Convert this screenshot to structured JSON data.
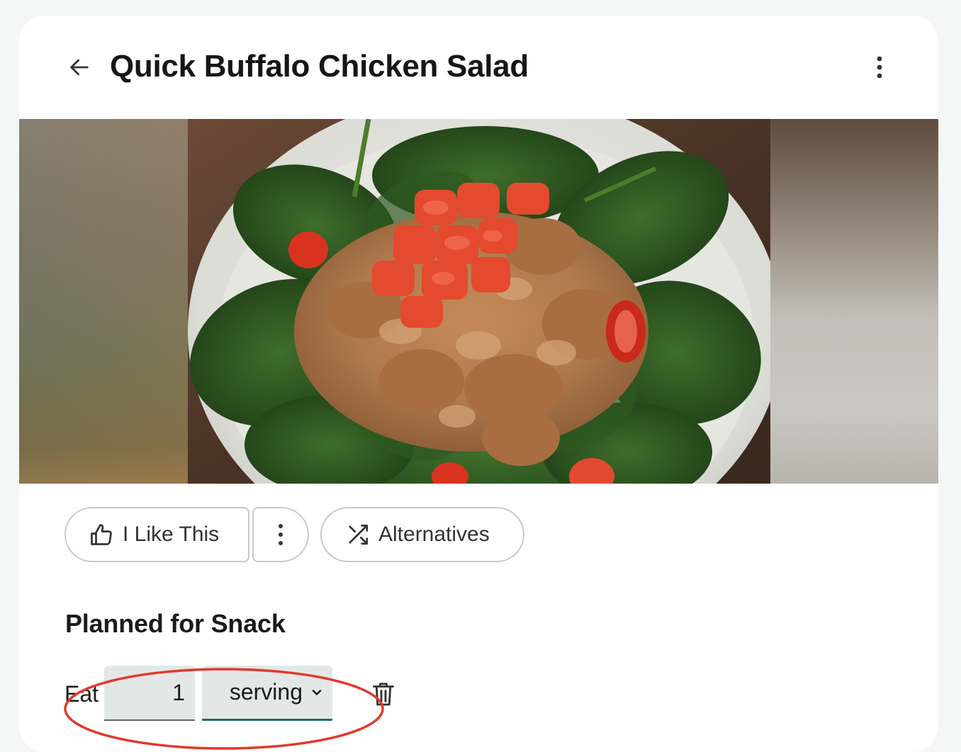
{
  "header": {
    "title": "Quick Buffalo Chicken Salad"
  },
  "hero": {
    "alt": "Buffalo chicken salad over spinach with diced tomatoes"
  },
  "actions": {
    "like_label": "I Like This",
    "alternatives_label": "Alternatives"
  },
  "plan": {
    "section_title": "Planned for Snack",
    "eat_label": "Eat",
    "quantity": "1",
    "unit": "serving"
  },
  "colors": {
    "accent_teal": "#1f6e6a",
    "annotation_red": "#e03a2b",
    "field_bg": "#e3e8e7"
  },
  "icons": [
    "arrow-left-icon",
    "more-vertical-icon",
    "thumbs-up-icon",
    "shuffle-icon",
    "chevron-down-icon",
    "trash-icon"
  ]
}
